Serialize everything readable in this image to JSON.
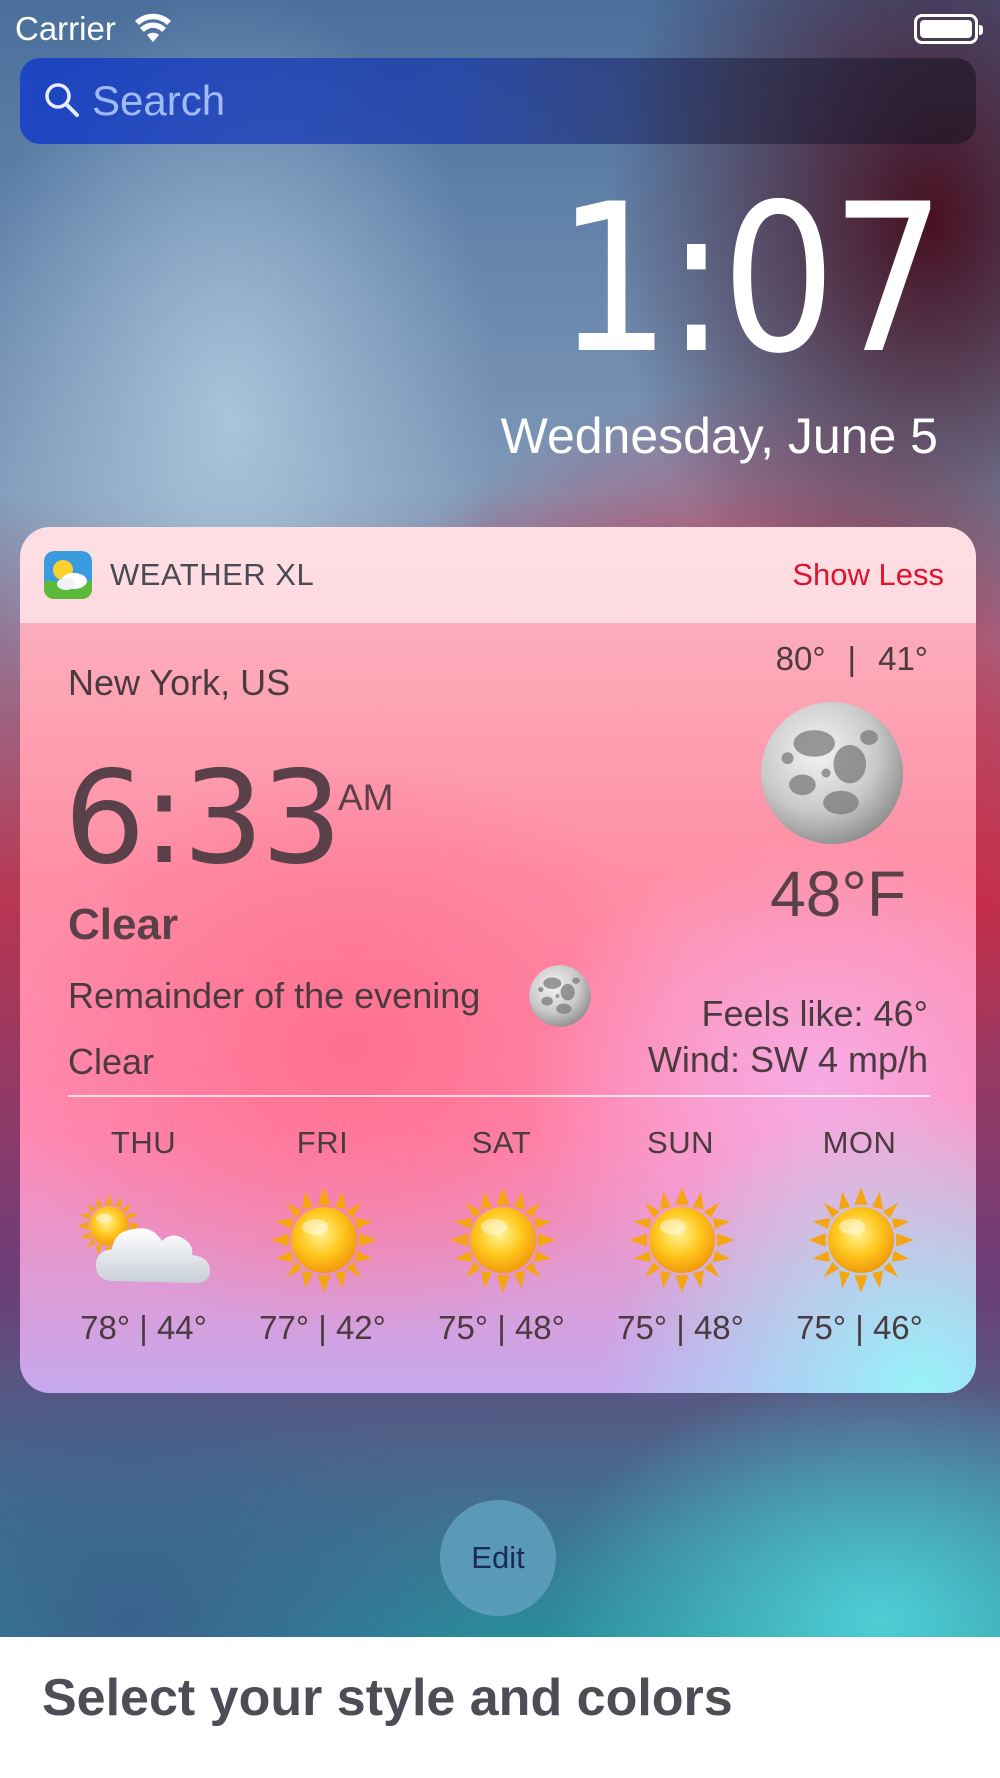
{
  "status_bar": {
    "carrier": "Carrier"
  },
  "search": {
    "placeholder": "Search"
  },
  "lock_screen": {
    "time": "1:07",
    "date": "Wednesday, June 5"
  },
  "widget": {
    "app_name": "WEATHER XL",
    "show_less_label": "Show Less",
    "location": "New York, US",
    "high": "80°",
    "high_low_separator": "|",
    "low": "41°",
    "time": "6:33",
    "am_pm": "AM",
    "temperature": "48°F",
    "condition": "Clear",
    "remainder_label": "Remainder of the evening",
    "remainder_condition": "Clear",
    "feels_like": "Feels like: 46°",
    "wind": "Wind: SW 4 mp/h",
    "forecast": [
      {
        "day": "THU",
        "icon": "partly-cloudy-icon",
        "temps": "78° | 44°"
      },
      {
        "day": "FRI",
        "icon": "sun-icon",
        "temps": "77° | 42°"
      },
      {
        "day": "SAT",
        "icon": "sun-icon",
        "temps": "75° | 48°"
      },
      {
        "day": "SUN",
        "icon": "sun-icon",
        "temps": "75° | 48°"
      },
      {
        "day": "MON",
        "icon": "sun-icon",
        "temps": "75° | 46°"
      }
    ]
  },
  "edit_label": "Edit",
  "caption": "Select your style and colors",
  "colors": {
    "accent_red": "#e0122e",
    "text_dark": "#5a4048"
  }
}
